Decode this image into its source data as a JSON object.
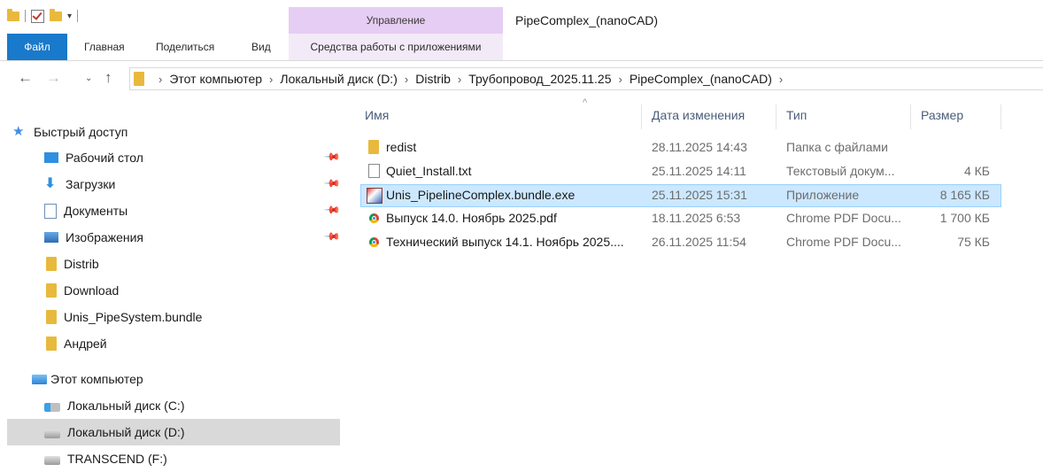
{
  "window": {
    "title": "PipeComplex_(nanoCAD)",
    "manage_tab": "Управление"
  },
  "ribbon": {
    "tabs": {
      "file": "Файл",
      "home": "Главная",
      "share": "Поделиться",
      "view": "Вид",
      "app_tools": "Средства работы с приложениями"
    }
  },
  "nav": {
    "back": "←",
    "forward": "→",
    "recent": "⌄",
    "up": "↑"
  },
  "address": {
    "crumbs": [
      "Этот компьютер",
      "Локальный диск (D:)",
      "Distrib",
      "Трубопровод_2025.11.25",
      "PipeComplex_(nanoCAD)"
    ],
    "separator": "›"
  },
  "sidebar": {
    "quick_access": "Быстрый доступ",
    "items": [
      {
        "label": "Рабочий стол",
        "icon": "desktop-icon",
        "pinned": true
      },
      {
        "label": "Загрузки",
        "icon": "downloads-icon",
        "pinned": true
      },
      {
        "label": "Документы",
        "icon": "documents-icon",
        "pinned": true
      },
      {
        "label": "Изображения",
        "icon": "pictures-icon",
        "pinned": true
      },
      {
        "label": "Distrib",
        "icon": "folder-icon",
        "pinned": false
      },
      {
        "label": "Download",
        "icon": "folder-icon",
        "pinned": false
      },
      {
        "label": "Unis_PipeSystem.bundle",
        "icon": "folder-icon",
        "pinned": false
      },
      {
        "label": "Андрей",
        "icon": "folder-icon",
        "pinned": false
      }
    ],
    "this_pc": "Этот компьютер",
    "drives": [
      {
        "label": "Локальный диск (C:)",
        "icon": "windows-drive-icon"
      },
      {
        "label": "Локальный диск (D:)",
        "icon": "drive-icon",
        "selected": true
      },
      {
        "label": "TRANSCEND (F:)",
        "icon": "drive-icon"
      }
    ],
    "pin_glyph": "📌"
  },
  "filelist": {
    "columns": {
      "name": "Имя",
      "date": "Дата изменения",
      "type": "Тип",
      "size": "Размер"
    },
    "sort_glyph": "^",
    "rows": [
      {
        "name": "redist",
        "date": "28.11.2025 14:43",
        "type": "Папка с файлами",
        "size": "",
        "icon": "folder-icon"
      },
      {
        "name": "Quiet_Install.txt",
        "date": "25.11.2025 14:11",
        "type": "Текстовый докум...",
        "size": "4 КБ",
        "icon": "text-file-icon"
      },
      {
        "name": "Unis_PipelineComplex.bundle.exe",
        "date": "25.11.2025 15:31",
        "type": "Приложение",
        "size": "8 165 КБ",
        "icon": "installer-icon",
        "selected": true
      },
      {
        "name": "Выпуск 14.0. Ноябрь 2025.pdf",
        "date": "18.11.2025 6:53",
        "type": "Chrome PDF Docu...",
        "size": "1 700 КБ",
        "icon": "chrome-pdf-icon"
      },
      {
        "name": "Технический выпуск 14.1. Ноябрь 2025....",
        "date": "26.11.2025 11:54",
        "type": "Chrome PDF Docu...",
        "size": "75 КБ",
        "icon": "chrome-pdf-icon"
      }
    ]
  },
  "colors": {
    "file_tab": "#1979ca",
    "manage_tab": "#e6cdf3",
    "selection": "#cce8ff",
    "folder": "#e8b93c"
  }
}
